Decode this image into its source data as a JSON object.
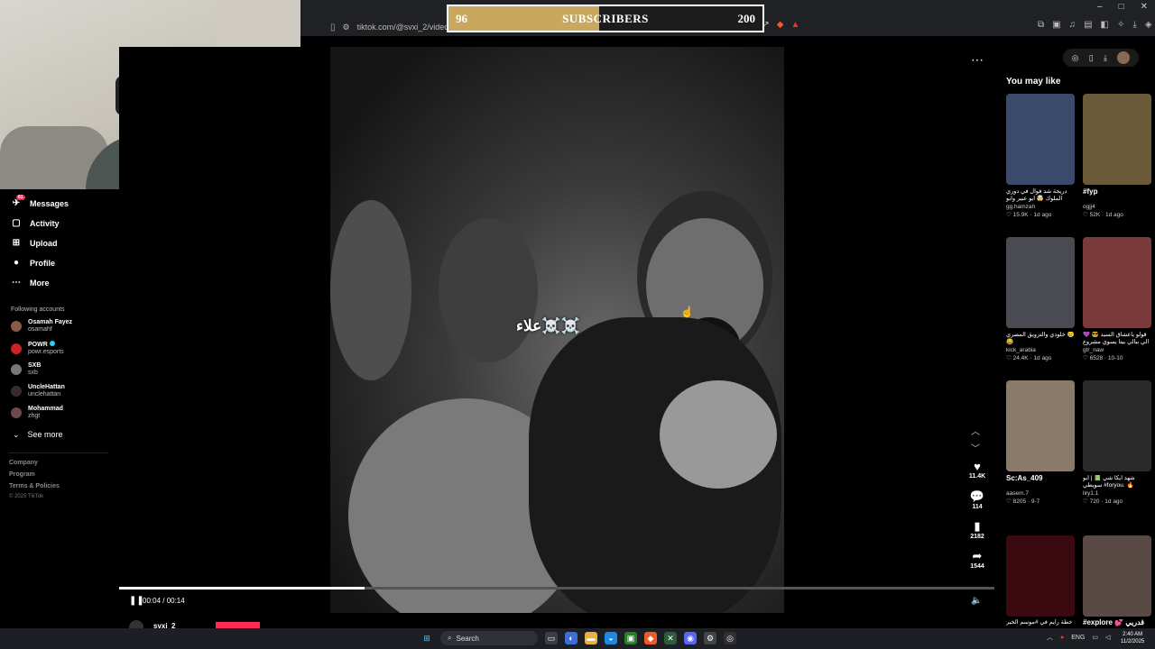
{
  "browser": {
    "url": "tiktok.com/@svxi_2/video/75675",
    "window_controls": [
      "–",
      "□",
      "✕"
    ]
  },
  "subscriber_goal": {
    "current": "96",
    "label": "SUBSCRIBERS",
    "target": "200",
    "progress_fraction": 0.48,
    "fill_color": "#c9a85e"
  },
  "sidebar": {
    "nav": [
      {
        "label": "Messages",
        "icon": "paper-plane-icon",
        "badge": "61"
      },
      {
        "label": "Activity",
        "icon": "activity-icon"
      },
      {
        "label": "Upload",
        "icon": "upload-icon"
      },
      {
        "label": "Profile",
        "icon": "profile-icon"
      },
      {
        "label": "More",
        "icon": "more-icon"
      }
    ],
    "following_title": "Following accounts",
    "accounts": [
      {
        "name": "Osamah Fayez",
        "handle": "osamahf"
      },
      {
        "name": "POWR",
        "handle": "powr.esports",
        "verified": true
      },
      {
        "name": "SXB",
        "handle": "sxb"
      },
      {
        "name": "UncleHattan",
        "handle": "unclehattan"
      },
      {
        "name": "Mohammad",
        "handle": "zhgt"
      }
    ],
    "see_more": "See more",
    "footer": [
      "Company",
      "Program",
      "Terms & Policies"
    ],
    "copyright": "© 2025 TikTok"
  },
  "video": {
    "overlay_text": "علاء☠️☠️",
    "time": "00:04 / 00:14",
    "progress_fraction": 0.28,
    "author": "svxi_2",
    "actions": [
      {
        "icon": "heart-icon",
        "count": "11.4K"
      },
      {
        "icon": "comment-icon",
        "count": "114"
      },
      {
        "icon": "bookmark-icon",
        "count": "2182"
      },
      {
        "icon": "share-icon",
        "count": "1544"
      }
    ]
  },
  "recommendations": {
    "title": "You may like",
    "cards": [
      {
        "caption": "دريجة شد فوال في دوري الملوك 🤯 ابو عبير وابو",
        "user": "gg.hamzah",
        "likes": "15.9K",
        "age": "1d ago",
        "color": "#3a4a6a"
      },
      {
        "caption": "#fyp",
        "big": true,
        "user": "ogjj4",
        "likes": "52K",
        "age": "1d ago",
        "color": "#6a5a3a"
      },
      {
        "caption": "خلودي والتزويق المصري 😢 😂",
        "user": "kick_arabia",
        "likes": "24.4K",
        "age": "1d ago",
        "color": "#4a4a52"
      },
      {
        "caption": "💜 قولو ياعشاق السيد 😎 الي ببالي بيتا يسوي مشروع",
        "user": "gtr_naw",
        "likes": "6528",
        "age": "10-10",
        "color": "#7a3a3a"
      },
      {
        "caption": "Sc:As_409",
        "big": true,
        "user": "aasem.7",
        "likes": "8205",
        "age": "9-7",
        "color": "#8a7a6a"
      },
      {
        "caption": "شهد ايكا شي 📗 | ابو سويطي #foryou. 🔥",
        "user": "liry1.1",
        "likes": "720",
        "age": "1d ago",
        "color": "#2a2a2a"
      },
      {
        "caption": "خطة رايم في #موسم الخبر",
        "user": "",
        "likes": "",
        "age": "",
        "color": "#3a0a10"
      },
      {
        "caption": "#explore 💕 قدريي",
        "user": "",
        "likes": "",
        "age": "",
        "color": "#5a4a45"
      }
    ]
  },
  "taskbar": {
    "search": "Search",
    "language": "ENG",
    "time": "2:40 AM",
    "date": "11/2/2025"
  }
}
